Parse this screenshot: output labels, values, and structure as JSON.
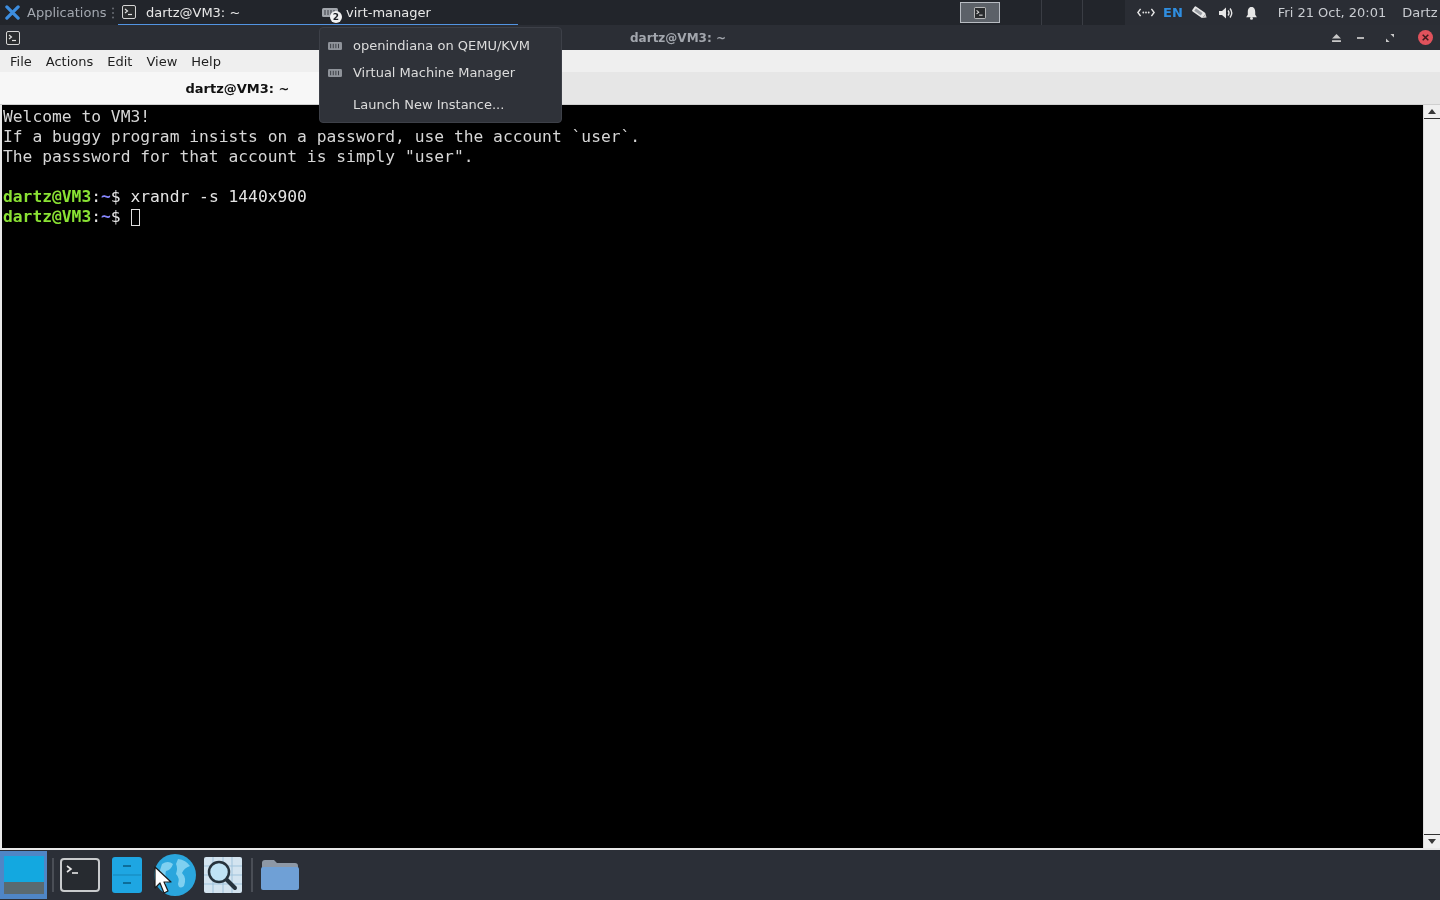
{
  "top_panel": {
    "app_menu": "Applications",
    "tasks": [
      {
        "title": "dartz@VM3: ~",
        "kind": "terminal",
        "selected": true
      },
      {
        "title": "virt-manager",
        "kind": "group",
        "badge": "2",
        "selected": true
      }
    ],
    "tray": {
      "keyboard_layout": "EN"
    },
    "clock": "Fri 21 Oct, 20:01",
    "user": "Dartz"
  },
  "window": {
    "title": "dartz@VM3: ~",
    "menu": [
      "File",
      "Actions",
      "Edit",
      "View",
      "Help"
    ],
    "tabs": [
      {
        "label": "dartz@VM3: ~",
        "selected": true
      }
    ],
    "terminal": {
      "lines": [
        {
          "kind": "output",
          "text": "Welcome to VM3!"
        },
        {
          "kind": "output",
          "text": "If a buggy program insists on a password, use the account `user`."
        },
        {
          "kind": "output",
          "text": "The passsword for that account is simply \"user\"."
        },
        {
          "kind": "blank"
        },
        {
          "kind": "prompt",
          "cursor": false,
          "segments": [
            {
              "text": "dartz@VM3",
              "color": "#8ae234",
              "bold": true
            },
            {
              "text": ":",
              "color": "#e4e4e4",
              "bold": false
            },
            {
              "text": "~",
              "color": "#8787ff",
              "bold": true
            },
            {
              "text": "$ xrandr -s 1440x900",
              "color": "#e4e4e4",
              "bold": false
            }
          ]
        },
        {
          "kind": "prompt",
          "cursor": true,
          "segments": [
            {
              "text": "dartz@VM3",
              "color": "#8ae234",
              "bold": true
            },
            {
              "text": ":",
              "color": "#e4e4e4",
              "bold": false
            },
            {
              "text": "~",
              "color": "#8787ff",
              "bold": true
            },
            {
              "text": "$",
              "color": "#e4e4e4",
              "bold": false
            }
          ]
        }
      ]
    }
  },
  "popup_menu": {
    "items": [
      {
        "label": "openindiana on QEMU/KVM",
        "kind": "window"
      },
      {
        "label": "Virtual Machine Manager",
        "kind": "window"
      },
      {
        "label": "Launch New Instance...",
        "kind": "action"
      }
    ]
  },
  "dock": {
    "show_desktop": {
      "selected": true
    }
  }
}
